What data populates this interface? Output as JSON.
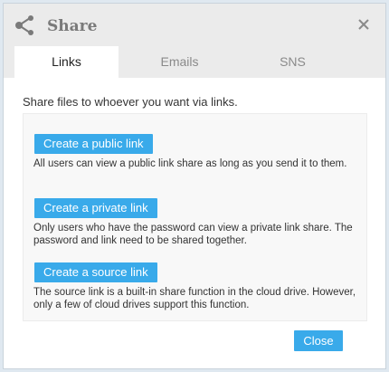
{
  "dialog": {
    "title": "Share",
    "icons": {
      "title_icon": "share-icon",
      "close_icon": "close-icon"
    }
  },
  "tabs": [
    {
      "label": "Links",
      "active": true
    },
    {
      "label": "Emails",
      "active": false
    },
    {
      "label": "SNS",
      "active": false
    }
  ],
  "links_tab": {
    "intro": "Share files to whoever you want via links.",
    "options": [
      {
        "button_label": "Create a public link",
        "description": "All users can view a public link share as long as you send it to them."
      },
      {
        "button_label": "Create a private link",
        "description": "Only users who have the password can view a private link share. The password and link need to be shared together."
      },
      {
        "button_label": "Create a source link",
        "description": "The source link is a built-in share function in the cloud drive. However, only a few of cloud drives support this function."
      }
    ]
  },
  "footer": {
    "close_label": "Close"
  },
  "colors": {
    "accent": "#39aaea",
    "titlebar": "#ebebeb",
    "panel": "#f8f8f8",
    "backdrop": "#dfe8f0"
  }
}
